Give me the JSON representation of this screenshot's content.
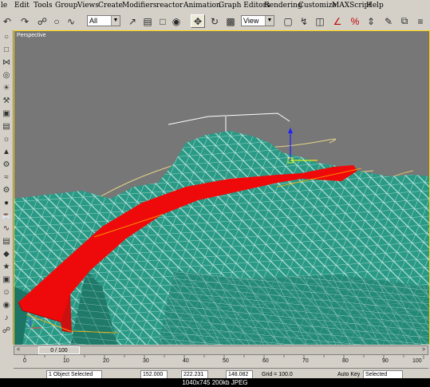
{
  "menu": {
    "items": [
      "le",
      "Edit",
      "Tools",
      "Group",
      "Views",
      "Create",
      "Modifiers",
      "reactor",
      "Animation",
      "Graph Editors",
      "Rendering",
      "Customize",
      "MAXScript",
      "Help"
    ]
  },
  "toolbar": {
    "selection_filter": "All",
    "reference_coord": "View"
  },
  "viewport": {
    "label": "Perspective"
  },
  "timeslider": {
    "label": "0 / 100",
    "prev_icon": "<",
    "next_icon": ">"
  },
  "timeline": {
    "ticks": [
      "0",
      "10",
      "20",
      "30",
      "40",
      "50",
      "60",
      "70",
      "80",
      "90",
      "100"
    ]
  },
  "status": {
    "selection": "1 Object Selected",
    "x": "152.000",
    "y": "222.231",
    "z": "148.082",
    "grid": "Grid = 100.0",
    "autokey": "Auto Key",
    "selected": "Selected"
  },
  "caption": "1040x745  200kb  JPEG"
}
